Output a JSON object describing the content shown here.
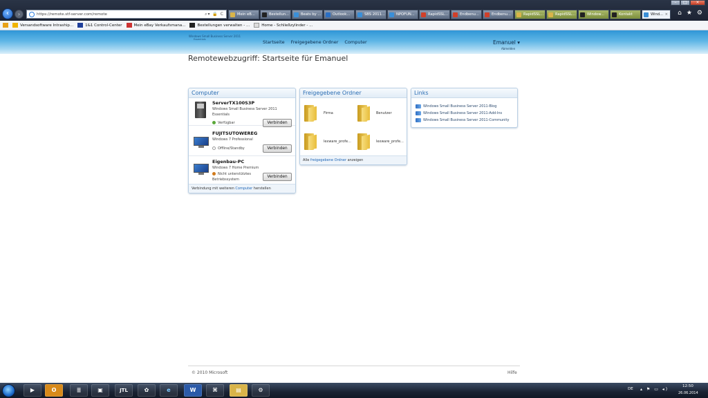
{
  "browser": {
    "url": "https://remote.stf-server.com/remote",
    "tabs": [
      {
        "label": "Mein eB..."
      },
      {
        "label": "Bestellun..."
      },
      {
        "label": "Beats by ..."
      },
      {
        "label": "Outlook..."
      },
      {
        "label": "SBS 2011..."
      },
      {
        "label": "NPOFUN..."
      },
      {
        "label": "RapidSSL..."
      },
      {
        "label": "Endbenu..."
      },
      {
        "label": "Endbenu..."
      },
      {
        "label": "RapidSSL..."
      },
      {
        "label": "RapidSSL..."
      },
      {
        "label": "Window..."
      },
      {
        "label": "Kontakt"
      },
      {
        "label": "Wind..."
      }
    ],
    "favorites": [
      {
        "label": "Versandsoftware Intraship..."
      },
      {
        "label": "1&1 Control-Center"
      },
      {
        "label": "Mein eBay Verkaufsmana..."
      },
      {
        "label": "Bestellungen verwalten - ..."
      },
      {
        "label": "Home - Schließzylinder - ..."
      }
    ]
  },
  "header": {
    "brand": "Windows Small Business Server 2011",
    "brand_sub": "Essentials",
    "nav": [
      "Startseite",
      "Freigegebene Ordner",
      "Computer"
    ],
    "user": "Emanuel ▾",
    "logout": "Abmelden"
  },
  "page_title": "Remotewebzugriff: Startseite für Emanuel",
  "computer_panel": {
    "title": "Computer",
    "items": [
      {
        "name": "ServerTX100S3P",
        "os": "Windows Small Business Server 2011 Essentials",
        "status": "Verfügbar",
        "button": "Verbinden"
      },
      {
        "name": "FUJITSUTOWEREG",
        "os": "Windows 7 Professional",
        "status": "Offline/Standby",
        "button": "Verbinden"
      },
      {
        "name": "Eigenbau-PC",
        "os": "Windows 7 Home Premium",
        "status": "Nicht unterstütztes Betriebssystem",
        "button": "Verbinden"
      }
    ],
    "footer_pre": "Verbindung mit weiteren ",
    "footer_link": "Computer",
    "footer_post": " herstellen"
  },
  "folders_panel": {
    "title": "Freigegebene Ordner",
    "items": [
      "Firma",
      "Benutzer",
      "lexware_profe...",
      "lexware_profe..."
    ],
    "footer_pre": "Alle ",
    "footer_link": "freigegebene Ordner",
    "footer_post": " anzeigen"
  },
  "links_panel": {
    "title": "Links",
    "items": [
      "Windows Small Business Server 2011-Blog",
      "Windows Small Business Server 2011-Add-Ins",
      "Windows Small Business Server 2011-Community"
    ]
  },
  "footer": {
    "copyright": "© 2010 Microsoft",
    "help": "Hilfe"
  },
  "taskbar": {
    "lang": "DE",
    "time": "12:50",
    "date": "26.06.2014",
    "apps": [
      "outlook-icon",
      "word-icon",
      "explorer-icon"
    ]
  },
  "colors": {
    "header_blue": "#2f96d6",
    "panel_title": "#2a6db3",
    "available": "#5aa83a",
    "offline": "#9a9a9a",
    "unsupported": "#d07a1c"
  }
}
